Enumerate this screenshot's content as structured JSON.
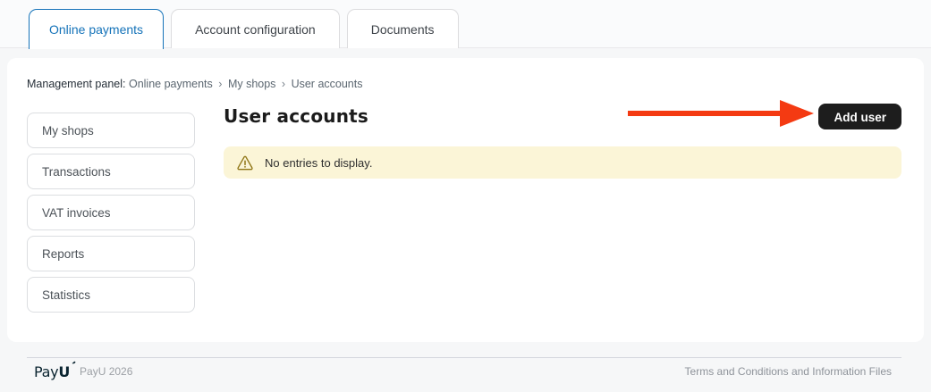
{
  "header": {
    "tabs": [
      {
        "label": "Online payments",
        "active": true
      },
      {
        "label": "Account configuration",
        "active": false
      },
      {
        "label": "Documents",
        "active": false
      }
    ]
  },
  "breadcrumb": {
    "prefix": "Management panel:",
    "separator": "›",
    "items": [
      "Online payments",
      "My shops",
      "User accounts"
    ]
  },
  "sidebar": {
    "items": [
      {
        "label": "My shops"
      },
      {
        "label": "Transactions"
      },
      {
        "label": "VAT invoices"
      },
      {
        "label": "Reports"
      },
      {
        "label": "Statistics"
      }
    ]
  },
  "main": {
    "title": "User accounts",
    "add_user_button": "Add user",
    "empty_notice": "No entries to display.",
    "warning_icon": "warning-triangle-icon"
  },
  "annotation": {
    "type": "red-arrow",
    "points_to": "Add user",
    "color": "#f43a12"
  },
  "footer": {
    "logo_pay": "Pay",
    "logo_u": "U",
    "logo_mark": "’",
    "copyright": "PayU 2026",
    "terms_link": "Terms and Conditions and Information Files"
  },
  "colors": {
    "active_tab": "#1573b9",
    "button_bg": "#1d1d1d",
    "banner_bg": "#fbf5d7",
    "banner_icon": "#8f7515",
    "arrow": "#f43a12",
    "panel_bg": "#ffffff",
    "page_bg": "#f6f7f8"
  }
}
